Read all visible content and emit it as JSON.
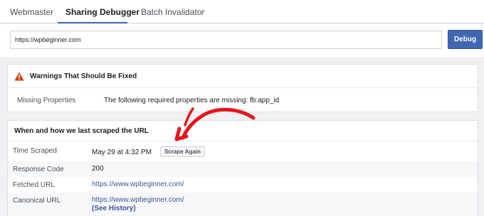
{
  "tabs": [
    {
      "label": "Webmaster",
      "active": false
    },
    {
      "label": "Sharing Debugger",
      "active": true
    },
    {
      "label": "Batch Invalidator",
      "active": false
    }
  ],
  "url_input": {
    "value": "https://wpbeginner.com"
  },
  "debug_button": {
    "label": "Debug"
  },
  "warnings": {
    "title": "Warnings That Should Be Fixed",
    "icon": "warning-triangle-icon",
    "missing_label": "Missing Properties",
    "missing_text": "The following required properties are missing: fb:app_id"
  },
  "scrape": {
    "title": "When and how we last scraped the URL",
    "rows": [
      {
        "label": "Time Scraped",
        "value": "May 29 at 4:32 PM"
      },
      {
        "label": "Response Code",
        "value": "200"
      },
      {
        "label": "Fetched URL",
        "value": "https://www.wpbeginner.com/"
      },
      {
        "label": "Canonical URL",
        "value": "https://www.wpbeginner.com/"
      }
    ],
    "scrape_again_label": "Scrape Again",
    "see_history_label": "(See History)"
  },
  "colors": {
    "accent": "#4267b2",
    "link": "#385898",
    "warning_red": "#dd3c10",
    "annotation_arrow": "#e8141a"
  }
}
